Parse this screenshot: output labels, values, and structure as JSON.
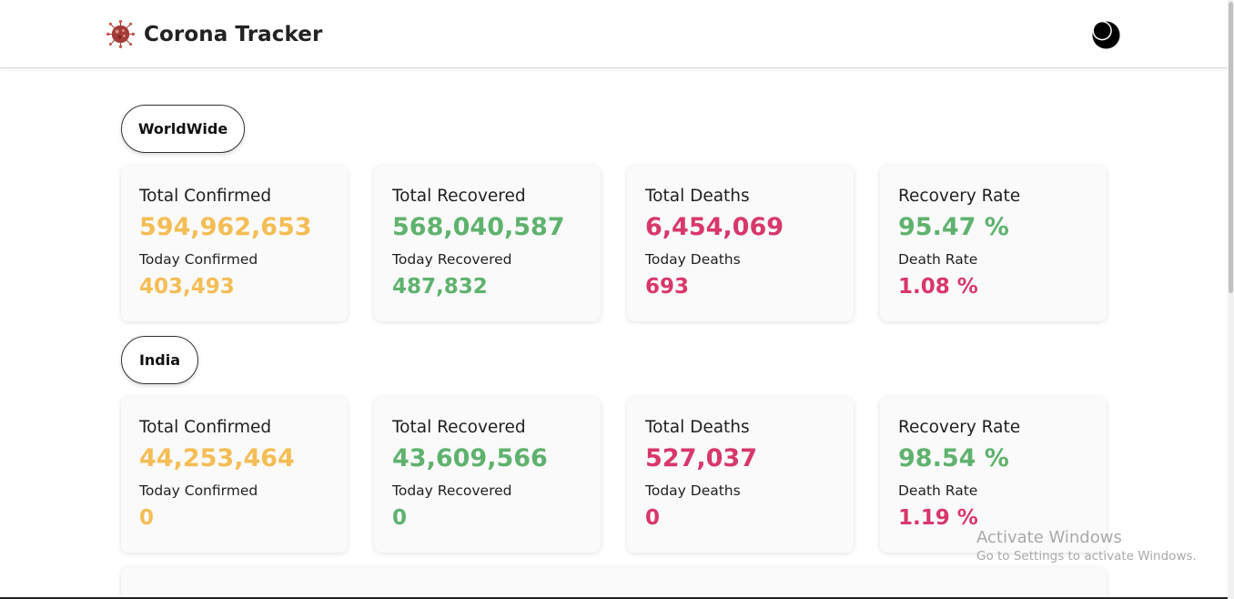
{
  "app": {
    "title": "Corona Tracker"
  },
  "icons": {
    "logo": "virus-logo-icon",
    "theme_toggle": "moon-icon"
  },
  "colors": {
    "confirmed": "#f4bd55",
    "recovered": "#5fb26e",
    "deaths": "#d8376a"
  },
  "worldwide": {
    "label": "WorldWide",
    "cards": [
      {
        "title": "Total Confirmed",
        "value": "594,962,653",
        "sub_title": "Today Confirmed",
        "sub_value": "403,493"
      },
      {
        "title": "Total Recovered",
        "value": "568,040,587",
        "sub_title": "Today Recovered",
        "sub_value": "487,832"
      },
      {
        "title": "Total Deaths",
        "value": "6,454,069",
        "sub_title": "Today Deaths",
        "sub_value": "693"
      },
      {
        "title": "Recovery Rate",
        "value": "95.47 %",
        "sub_title": "Death Rate",
        "sub_value": "1.08 %"
      }
    ]
  },
  "india": {
    "label": "India",
    "cards": [
      {
        "title": "Total Confirmed",
        "value": "44,253,464",
        "sub_title": "Today Confirmed",
        "sub_value": "0"
      },
      {
        "title": "Total Recovered",
        "value": "43,609,566",
        "sub_title": "Today Recovered",
        "sub_value": "0"
      },
      {
        "title": "Total Deaths",
        "value": "527,037",
        "sub_title": "Today Deaths",
        "sub_value": "0"
      },
      {
        "title": "Recovery Rate",
        "value": "98.54 %",
        "sub_title": "Death Rate",
        "sub_value": "1.19 %"
      }
    ]
  },
  "watermark": {
    "line1": "Activate Windows",
    "line2": "Go to Settings to activate Windows."
  }
}
